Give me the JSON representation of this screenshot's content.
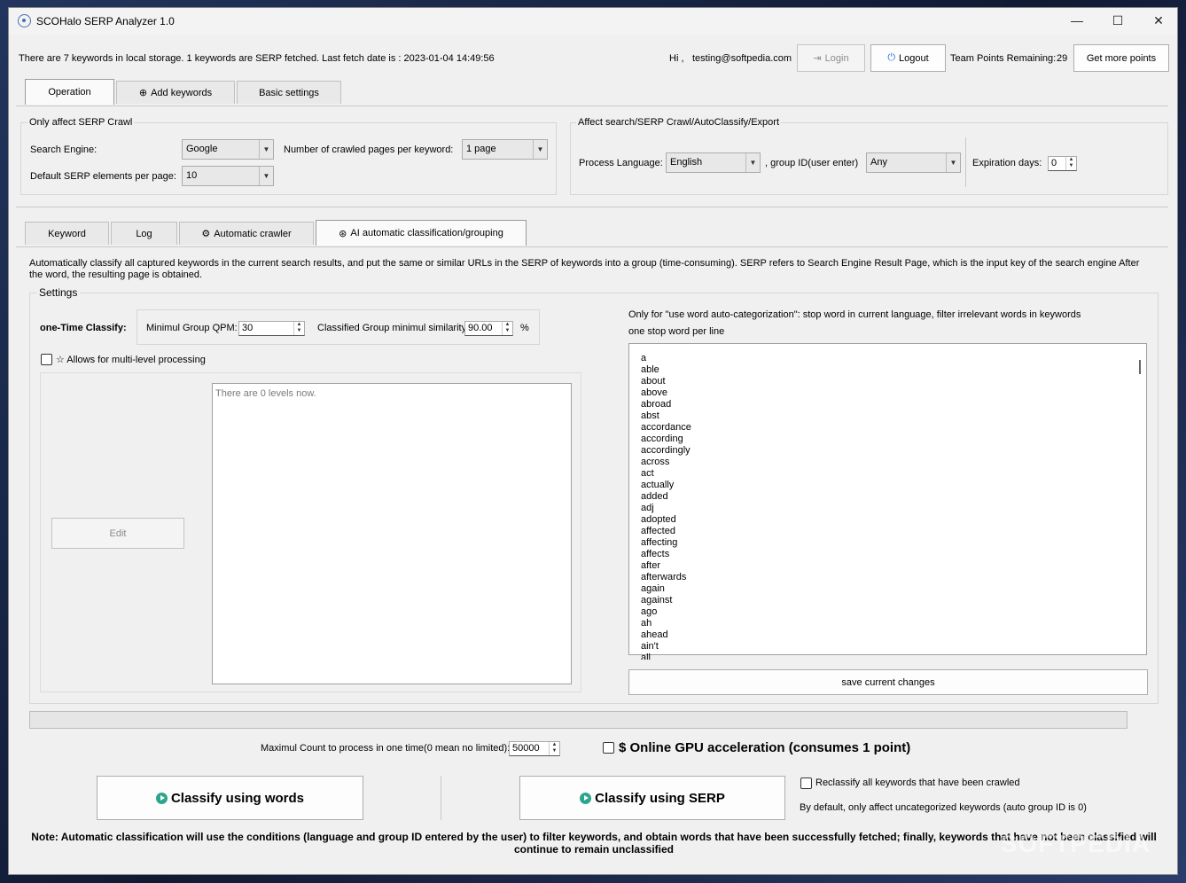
{
  "window": {
    "title": "SCOHalo SERP Analyzer 1.0",
    "min": "—",
    "max": "☐",
    "close": "✕"
  },
  "header": {
    "storage_info": "There are 7 keywords in local storage. 1 keywords are SERP fetched. Last fetch date is : 2023-01-04 14:49:56",
    "greeting": "Hi ,",
    "user": "testing@softpedia.com",
    "login": "Login",
    "logout": "Logout",
    "points_label": "Team Points Remaining:",
    "points_value": "29",
    "get_points": "Get more points"
  },
  "top_tabs": {
    "operation": "Operation",
    "add_keywords": "Add keywords",
    "basic_settings": "Basic settings"
  },
  "serp_crawl": {
    "legend": "Only affect SERP Crawl",
    "engine_label": "Search Engine:",
    "engine_value": "Google",
    "pages_label": "Number of crawled pages per keyword:",
    "pages_value": "1 page",
    "elements_label": "Default SERP elements per page:",
    "elements_value": "10"
  },
  "affect_group": {
    "legend": "Affect search/SERP Crawl/AutoClassify/Export",
    "lang_label": "Process Language:",
    "lang_value": "English",
    "group_label": ", group ID(user enter)",
    "group_value": "Any",
    "exp_label": "Expiration days:",
    "exp_value": "0"
  },
  "sub_tabs": {
    "keyword": "Keyword",
    "log": "Log",
    "auto_crawler": "Automatic crawler",
    "ai": "AI automatic classification/grouping"
  },
  "description": "Automatically classify all captured keywords in the current search results, and put the same or similar URLs in the SERP of keywords into a group (time-consuming). SERP refers to Search Engine Result Page, which is the input key of the search engine After the word, the resulting page is obtained.",
  "settings": {
    "legend": "Settings",
    "one_time": "one-Time Classify:",
    "qpm_label": "Minimul Group QPM:",
    "qpm_value": "30",
    "sim_label": "Classified Group minimul similarity",
    "sim_value": "90.00",
    "sim_unit": "%",
    "multi_level": "☆ Allows for multi-level processing",
    "edit": "Edit",
    "levels_placeholder": "There are 0 levels now.",
    "stop_note": "Only for \"use word auto-categorization\": stop word in current language, filter irrelevant words in keywords",
    "stop_note2": "one stop word per line",
    "save": "save current changes",
    "stop_words": "a\nable\nabout\nabove\nabroad\nabst\naccordance\naccording\naccordingly\nacross\nact\nactually\nadded\nadj\nadopted\naffected\naffecting\naffects\nafter\nafterwards\nagain\nagainst\nago\nah\nahead\nain't\nall"
  },
  "bottom": {
    "max_label": "Maximul Count to process in one time(0 mean no limited):",
    "max_value": "50000",
    "gpu": "$ Online GPU acceleration (consumes 1 point)",
    "classify_words": "Classify using words",
    "classify_serp": "Classify using SERP",
    "reclassify": "Reclassify all keywords that have been crawled",
    "default_note": "By default, only affect uncategorized keywords (auto group ID is 0)",
    "note": "Note: Automatic classification will use the conditions (language and group ID entered by the user) to filter keywords, and obtain words that have been successfully fetched; finally, keywords that have not been classified will continue to remain unclassified"
  },
  "watermark": "SOFTPEDIA"
}
